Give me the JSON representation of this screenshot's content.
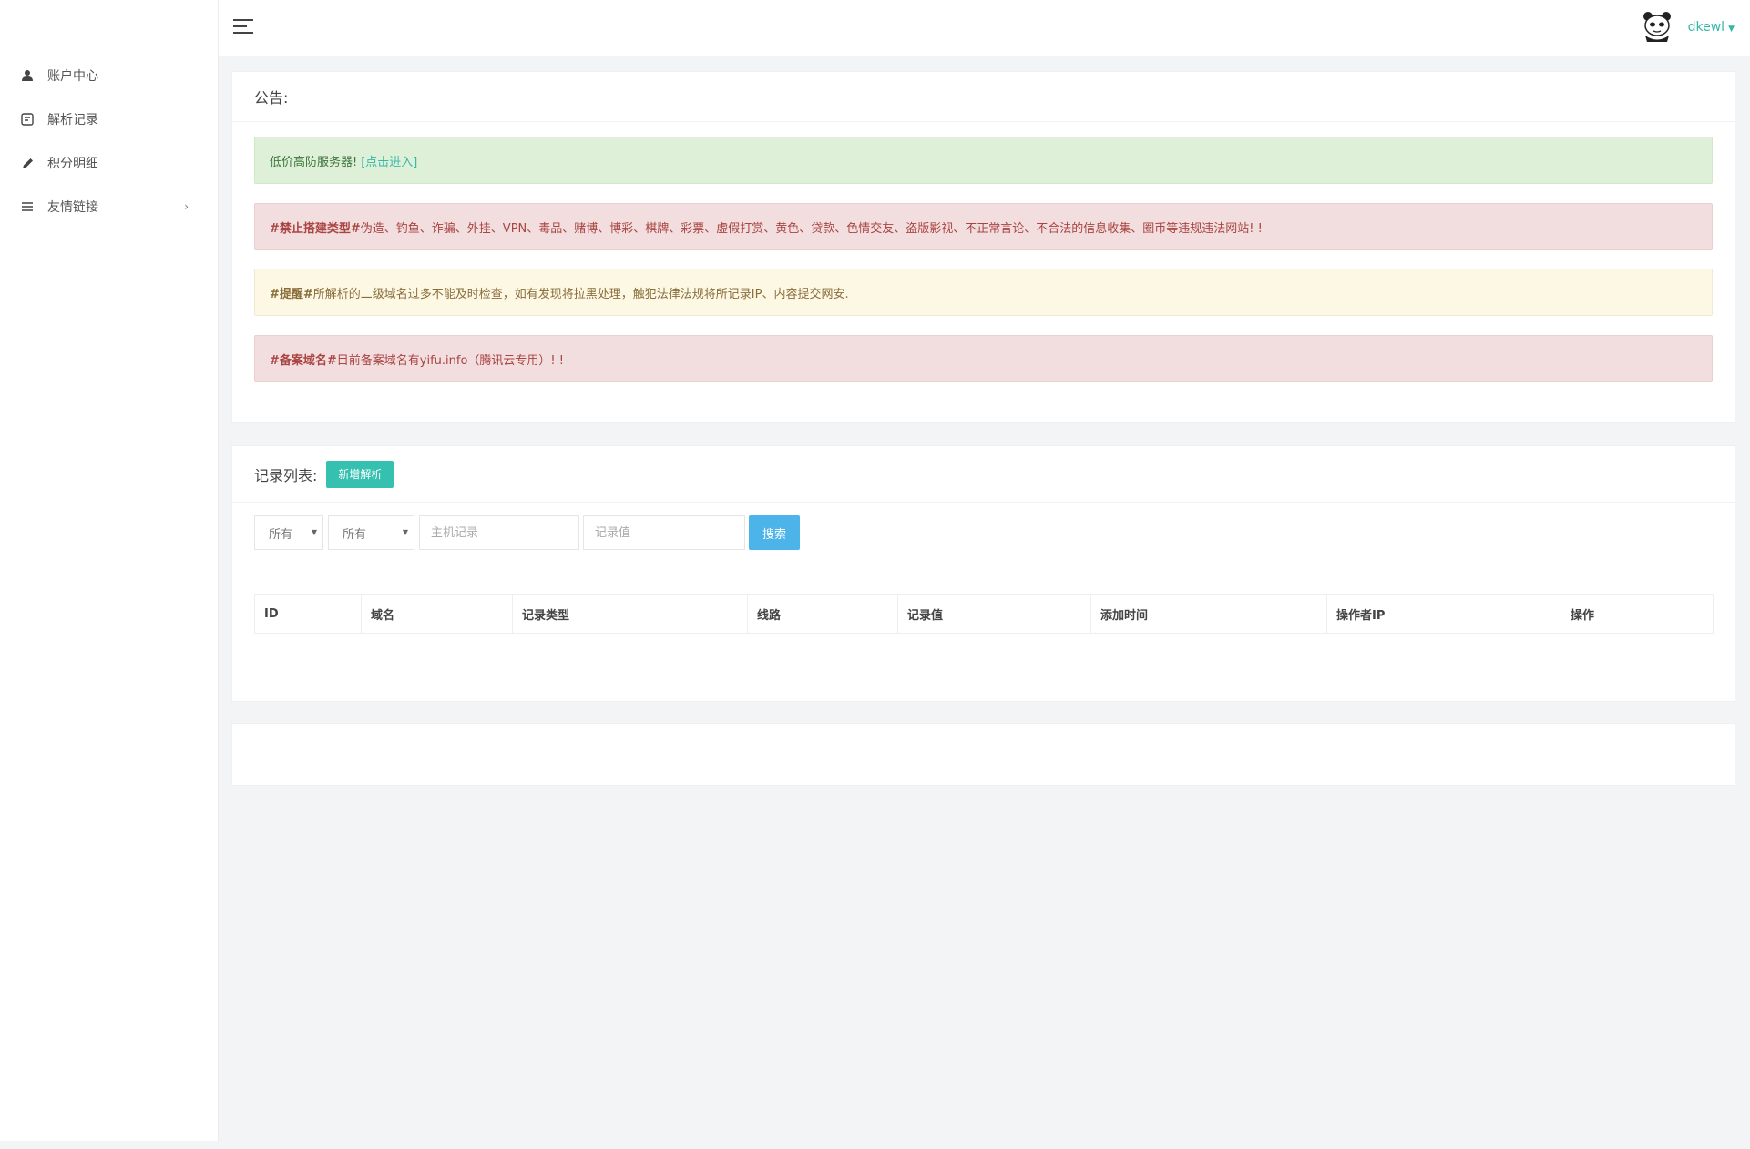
{
  "sidebar": {
    "items": [
      {
        "label": "账户中心",
        "icon": "user-icon"
      },
      {
        "label": "解析记录",
        "icon": "record-icon"
      },
      {
        "label": "积分明细",
        "icon": "pencil-icon"
      },
      {
        "label": "友情链接",
        "icon": "list-icon",
        "has_submenu": true
      }
    ]
  },
  "topbar": {
    "username": "dkewl"
  },
  "notice": {
    "title": "公告:",
    "alerts": [
      {
        "type": "success",
        "text": "低价高防服务器!",
        "link_text": "[点击进入]"
      },
      {
        "type": "danger",
        "bold": "#禁止搭建类型#",
        "text": " 伪造、钓鱼、诈骗、外挂、VPN、毒品、赌博、博彩、棋牌、彩票、虚假打赏、黄色、贷款、色情交友、盗版影视、不正常言论、不合法的信息收集、圈币等违规违法网站! !"
      },
      {
        "type": "warning",
        "bold": "#提醒#",
        "text": " 所解析的二级域名过多不能及时检查，如有发现将拉黑处理，触犯法律法规将所记录IP、内容提交网安."
      },
      {
        "type": "danger",
        "bold": "#备案域名#",
        "text": " 目前备案域名有yifu.info（腾讯云专用）! !"
      }
    ]
  },
  "records": {
    "title": "记录列表:",
    "add_button": "新增解析",
    "filters": {
      "select1": "所有",
      "select2": "所有",
      "host_placeholder": "主机记录",
      "value_placeholder": "记录值",
      "search_button": "搜索"
    },
    "columns": [
      "ID",
      "域名",
      "记录类型",
      "线路",
      "记录值",
      "添加时间",
      "操作者IP",
      "操作"
    ]
  },
  "colors": {
    "accent": "#35c0b0",
    "search_button": "#4db4ea",
    "success_bg": "#dff0d8",
    "danger_bg": "#f2dede",
    "warning_bg": "#fcf8e3"
  }
}
